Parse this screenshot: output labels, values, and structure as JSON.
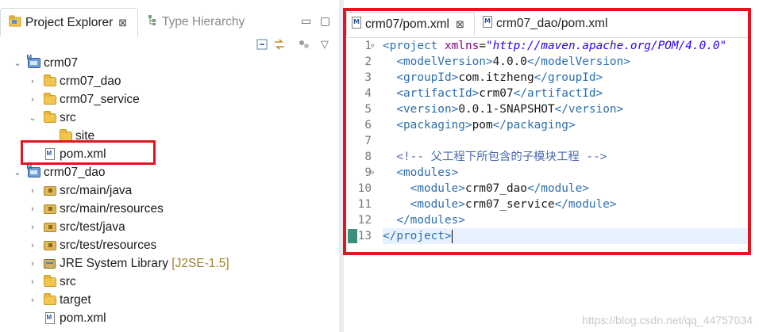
{
  "left_panel": {
    "tabs": [
      {
        "label": "Project Explorer",
        "close": "⊠"
      },
      {
        "label": "Type Hierarchy"
      }
    ],
    "tree": [
      {
        "label": "crm07",
        "expanded": true,
        "icon": "maven-project-icon"
      },
      {
        "label": "crm07_dao",
        "expanded": false,
        "icon": "folder-icon"
      },
      {
        "label": "crm07_service",
        "expanded": false,
        "icon": "folder-icon"
      },
      {
        "label": "src",
        "expanded": true,
        "icon": "folder-icon"
      },
      {
        "label": "site",
        "icon": "folder-icon"
      },
      {
        "label": "pom.xml",
        "icon": "xml-file-icon"
      },
      {
        "label": "crm07_dao",
        "expanded": true,
        "icon": "maven-project-icon"
      },
      {
        "label": "src/main/java",
        "expanded": false,
        "icon": "package-folder-icon"
      },
      {
        "label": "src/main/resources",
        "expanded": false,
        "icon": "package-folder-icon"
      },
      {
        "label": "src/test/java",
        "expanded": false,
        "icon": "package-folder-icon"
      },
      {
        "label": "src/test/resources",
        "expanded": false,
        "icon": "package-folder-icon"
      },
      {
        "label": "JRE System Library",
        "decoration": "[J2SE-1.5]",
        "expanded": false,
        "icon": "library-icon"
      },
      {
        "label": "src",
        "expanded": false,
        "icon": "folder-icon"
      },
      {
        "label": "target",
        "expanded": false,
        "icon": "folder-icon"
      },
      {
        "label": "pom.xml",
        "icon": "xml-file-icon"
      }
    ]
  },
  "editor": {
    "tabs": [
      {
        "label": "crm07/pom.xml",
        "close": "⊠",
        "active": true
      },
      {
        "label": "crm07_dao/pom.xml",
        "active": false
      }
    ],
    "code": {
      "line_numbers": [
        "1",
        "2",
        "3",
        "4",
        "5",
        "6",
        "7",
        "8",
        "9",
        "10",
        "11",
        "12",
        "13"
      ],
      "line1": {
        "tag": "<project",
        "attr": "xmlns",
        "eq": "=",
        "value": "\"http://maven.apache.org/POM/4.0.0\""
      },
      "line2": {
        "open": "<modelVersion>",
        "text": "4.0.0",
        "close": "</modelVersion>"
      },
      "line3": {
        "open": "<groupId>",
        "text": "com.itzheng",
        "close": "</groupId>"
      },
      "line4": {
        "open": "<artifactId>",
        "text": "crm07",
        "close": "</artifactId>"
      },
      "line5": {
        "open": "<version>",
        "text": "0.0.1-SNAPSHOT",
        "close": "</version>"
      },
      "line6": {
        "open": "<packaging>",
        "text": "pom",
        "close": "</packaging>"
      },
      "line8": {
        "comment": "<!-- 父工程下所包含的子模块工程 -->"
      },
      "line9": {
        "open": "<modules>"
      },
      "line10": {
        "open": "<module>",
        "text": "crm07_dao",
        "close": "</module>"
      },
      "line11": {
        "open": "<module>",
        "text": "crm07_service",
        "close": "</module>"
      },
      "line12": {
        "close": "</modules>"
      },
      "line13": {
        "close": "</project>"
      }
    }
  },
  "watermark": "https://blog.csdn.net/qq_44757034",
  "colors": {
    "highlight_red": "#e3141e",
    "xml_tag": "#2c6fb0",
    "xml_attribute": "#7f007f",
    "xml_value": "#2a00ff"
  }
}
